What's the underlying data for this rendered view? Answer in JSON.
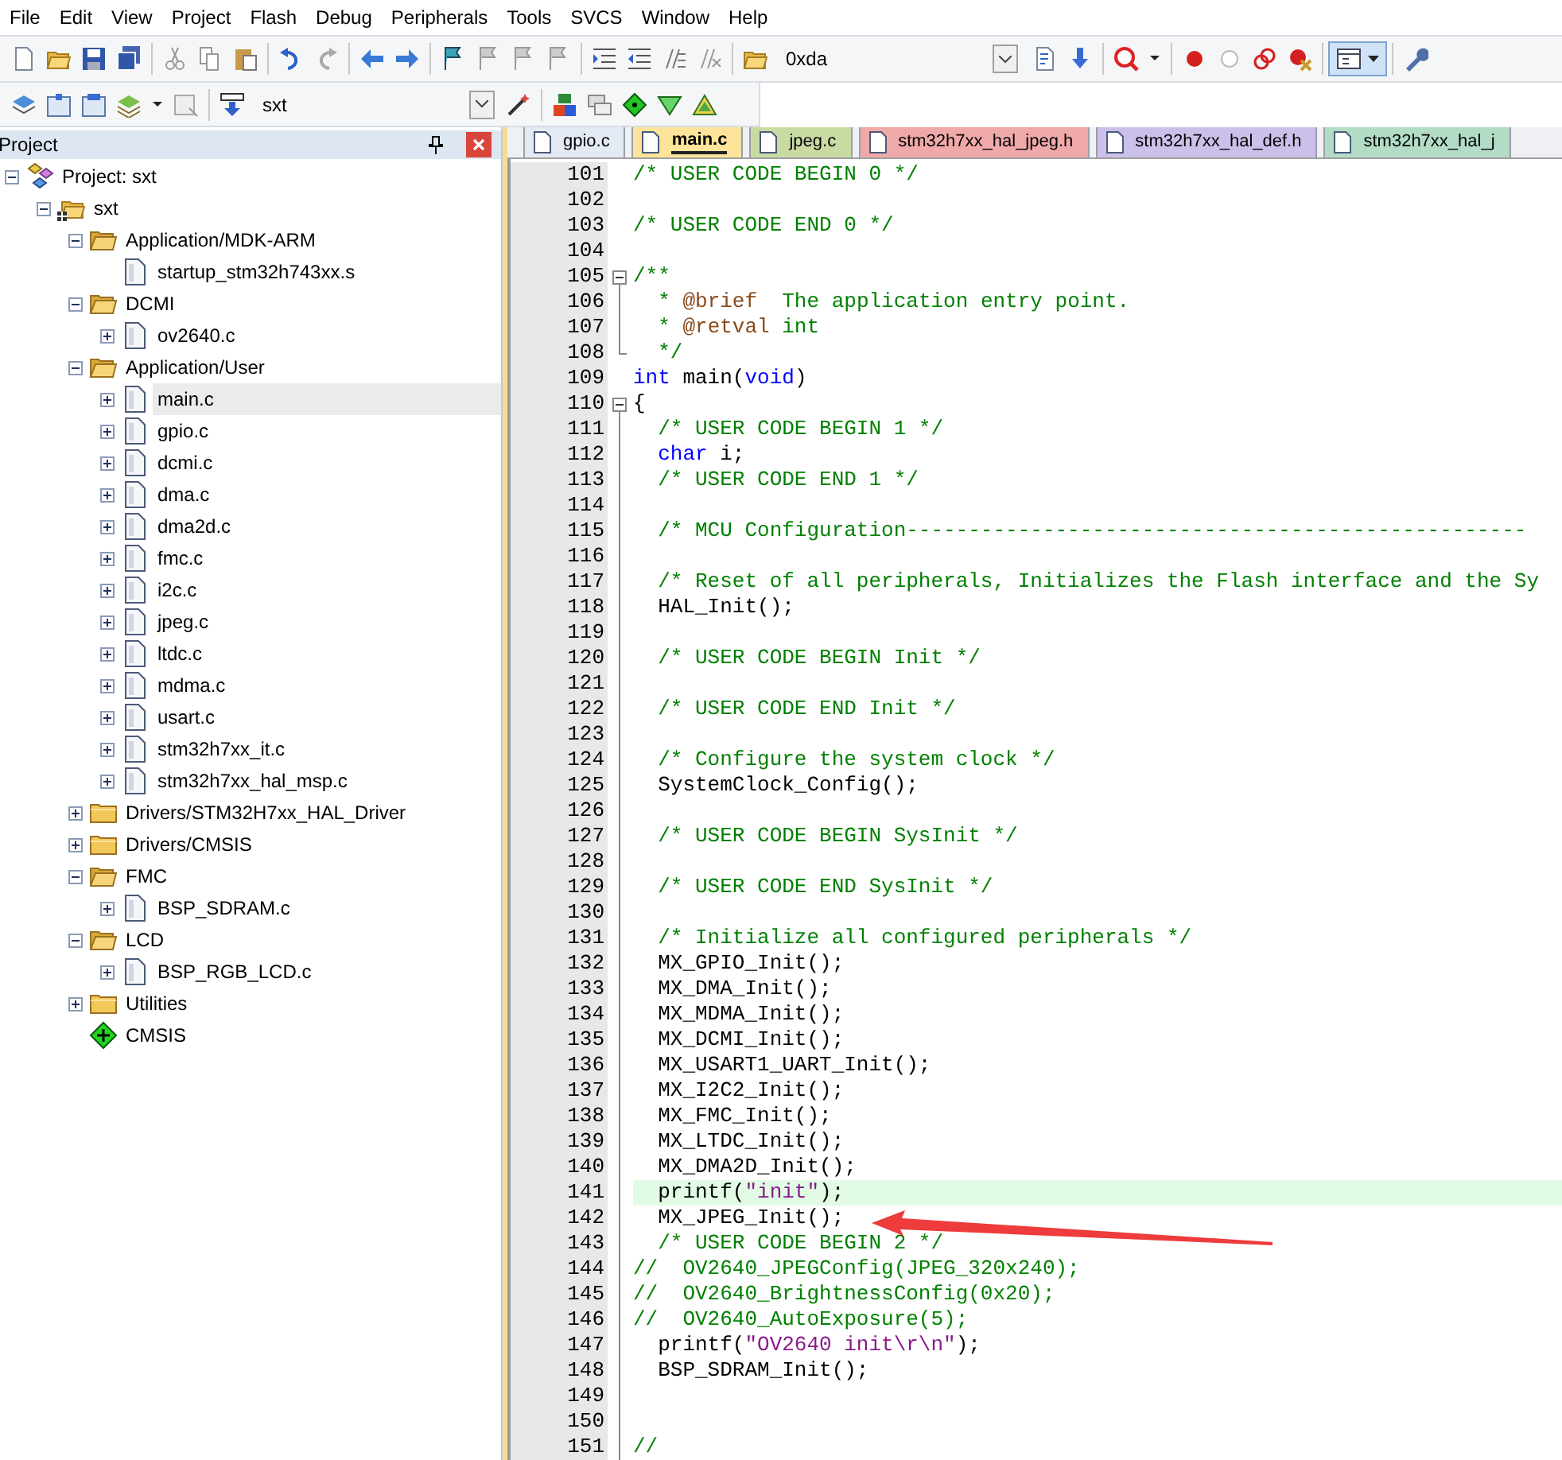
{
  "menu": [
    "File",
    "Edit",
    "View",
    "Project",
    "Flash",
    "Debug",
    "Peripherals",
    "Tools",
    "SVCS",
    "Window",
    "Help"
  ],
  "toolbar": {
    "find_combo": {
      "value": "0xda"
    },
    "target_combo": {
      "value": "sxt"
    }
  },
  "project_panel": {
    "title": "Project",
    "tree": [
      {
        "label": "Project: sxt",
        "kind": "project",
        "expanded": true,
        "selected": false,
        "children": [
          {
            "label": "sxt",
            "kind": "target",
            "expanded": true,
            "selected": false,
            "children": [
              {
                "label": "Application/MDK-ARM",
                "kind": "group",
                "expanded": true,
                "selected": false,
                "children": [
                  {
                    "label": "startup_stm32h743xx.s",
                    "kind": "file",
                    "selected": false
                  }
                ]
              },
              {
                "label": "DCMI",
                "kind": "group",
                "expanded": true,
                "selected": false,
                "children": [
                  {
                    "label": "ov2640.c",
                    "kind": "file",
                    "expanded": false,
                    "selected": false
                  }
                ]
              },
              {
                "label": "Application/User",
                "kind": "group",
                "expanded": true,
                "selected": false,
                "children": [
                  {
                    "label": "main.c",
                    "kind": "file",
                    "expanded": false,
                    "selected": true
                  },
                  {
                    "label": "gpio.c",
                    "kind": "file",
                    "expanded": false,
                    "selected": false
                  },
                  {
                    "label": "dcmi.c",
                    "kind": "file",
                    "expanded": false,
                    "selected": false
                  },
                  {
                    "label": "dma.c",
                    "kind": "file",
                    "expanded": false,
                    "selected": false
                  },
                  {
                    "label": "dma2d.c",
                    "kind": "file",
                    "expanded": false,
                    "selected": false
                  },
                  {
                    "label": "fmc.c",
                    "kind": "file",
                    "expanded": false,
                    "selected": false
                  },
                  {
                    "label": "i2c.c",
                    "kind": "file",
                    "expanded": false,
                    "selected": false
                  },
                  {
                    "label": "jpeg.c",
                    "kind": "file",
                    "expanded": false,
                    "selected": false
                  },
                  {
                    "label": "ltdc.c",
                    "kind": "file",
                    "expanded": false,
                    "selected": false
                  },
                  {
                    "label": "mdma.c",
                    "kind": "file",
                    "expanded": false,
                    "selected": false
                  },
                  {
                    "label": "usart.c",
                    "kind": "file",
                    "expanded": false,
                    "selected": false
                  },
                  {
                    "label": "stm32h7xx_it.c",
                    "kind": "file",
                    "expanded": false,
                    "selected": false
                  },
                  {
                    "label": "stm32h7xx_hal_msp.c",
                    "kind": "file",
                    "expanded": false,
                    "selected": false
                  }
                ]
              },
              {
                "label": "Drivers/STM32H7xx_HAL_Driver",
                "kind": "group",
                "expanded": false,
                "selected": false
              },
              {
                "label": "Drivers/CMSIS",
                "kind": "group",
                "expanded": false,
                "selected": false
              },
              {
                "label": "FMC",
                "kind": "group",
                "expanded": true,
                "selected": false,
                "children": [
                  {
                    "label": "BSP_SDRAM.c",
                    "kind": "file",
                    "expanded": false,
                    "selected": false
                  }
                ]
              },
              {
                "label": "LCD",
                "kind": "group",
                "expanded": true,
                "selected": false,
                "children": [
                  {
                    "label": "BSP_RGB_LCD.c",
                    "kind": "file",
                    "expanded": false,
                    "selected": false
                  }
                ]
              },
              {
                "label": "Utilities",
                "kind": "group",
                "expanded": false,
                "selected": false
              },
              {
                "label": "CMSIS",
                "kind": "component",
                "selected": false
              }
            ]
          }
        ]
      }
    ]
  },
  "editor": {
    "tabs": [
      {
        "label": "gpio.c",
        "selected": false,
        "color": "#e4eaf4"
      },
      {
        "label": "main.c",
        "selected": true,
        "color": "#fde49a"
      },
      {
        "label": "jpeg.c",
        "selected": false,
        "color": "#c9dba3"
      },
      {
        "label": "stm32h7xx_hal_jpeg.h",
        "selected": false,
        "color": "#f0a9a9"
      },
      {
        "label": "stm32h7xx_hal_def.h",
        "selected": false,
        "color": "#cbc0ea"
      },
      {
        "label": "stm32h7xx_hal_j",
        "selected": false,
        "color": "#b2dcc6"
      }
    ],
    "lines": [
      {
        "number": "101",
        "highlighted": false,
        "kind": "plain",
        "tokens": [
          {
            "kind": "comment",
            "text": "/* USER CODE BEGIN 0 */"
          }
        ]
      },
      {
        "number": "102",
        "highlighted": false,
        "kind": "plain"
      },
      {
        "number": "103",
        "highlighted": false,
        "kind": "plain",
        "tokens": [
          {
            "kind": "comment",
            "text": "/* USER CODE END 0 */"
          }
        ]
      },
      {
        "number": "104",
        "highlighted": false,
        "kind": "plain"
      },
      {
        "number": "105",
        "highlighted": false,
        "kind": "opener",
        "tokens": [
          {
            "kind": "comment",
            "text": "/**"
          }
        ]
      },
      {
        "number": "106",
        "highlighted": false,
        "kind": "body",
        "tokens": [
          {
            "kind": "comment",
            "text": "  * "
          },
          {
            "kind": "doc-tag",
            "text": "@brief"
          },
          {
            "kind": "comment",
            "text": "  The application entry point."
          }
        ]
      },
      {
        "number": "107",
        "highlighted": false,
        "kind": "body",
        "tokens": [
          {
            "kind": "comment",
            "text": "  * "
          },
          {
            "kind": "doc-tag",
            "text": "@retval"
          },
          {
            "kind": "comment",
            "text": " int"
          }
        ]
      },
      {
        "number": "108",
        "highlighted": false,
        "kind": "closer",
        "tokens": [
          {
            "kind": "comment",
            "text": "  */"
          }
        ]
      },
      {
        "number": "109",
        "highlighted": false,
        "kind": "plain",
        "tokens": [
          {
            "kind": "keyword",
            "text": "int"
          },
          {
            "kind": "plain",
            "text": " main("
          },
          {
            "kind": "keyword",
            "text": "void"
          },
          {
            "kind": "plain",
            "text": ")"
          }
        ]
      },
      {
        "number": "110",
        "highlighted": false,
        "kind": "opener",
        "tokens": [
          {
            "kind": "plain",
            "text": "{"
          }
        ]
      },
      {
        "number": "111",
        "highlighted": false,
        "kind": "body",
        "tokens": [
          {
            "kind": "comment",
            "text": "  /* USER CODE BEGIN 1 */"
          }
        ]
      },
      {
        "number": "112",
        "highlighted": false,
        "kind": "body",
        "tokens": [
          {
            "kind": "keyword",
            "text": "  char"
          },
          {
            "kind": "plain",
            "text": " i;"
          }
        ]
      },
      {
        "number": "113",
        "highlighted": false,
        "kind": "body",
        "tokens": [
          {
            "kind": "comment",
            "text": "  /* USER CODE END 1 */"
          }
        ]
      },
      {
        "number": "114",
        "highlighted": false,
        "kind": "body"
      },
      {
        "number": "115",
        "highlighted": false,
        "kind": "body",
        "tokens": [
          {
            "kind": "comment",
            "text": "  /* MCU Configuration--------------------------------------------------"
          }
        ]
      },
      {
        "number": "116",
        "highlighted": false,
        "kind": "body"
      },
      {
        "number": "117",
        "highlighted": false,
        "kind": "body",
        "tokens": [
          {
            "kind": "comment",
            "text": "  /* Reset of all peripherals, Initializes the Flash interface and the Sy"
          }
        ]
      },
      {
        "number": "118",
        "highlighted": false,
        "kind": "body",
        "tokens": [
          {
            "kind": "plain",
            "text": "  HAL_Init();"
          }
        ]
      },
      {
        "number": "119",
        "highlighted": false,
        "kind": "body"
      },
      {
        "number": "120",
        "highlighted": false,
        "kind": "body",
        "tokens": [
          {
            "kind": "comment",
            "text": "  /* USER CODE BEGIN Init */"
          }
        ]
      },
      {
        "number": "121",
        "highlighted": false,
        "kind": "body"
      },
      {
        "number": "122",
        "highlighted": false,
        "kind": "body",
        "tokens": [
          {
            "kind": "comment",
            "text": "  /* USER CODE END Init */"
          }
        ]
      },
      {
        "number": "123",
        "highlighted": false,
        "kind": "body"
      },
      {
        "number": "124",
        "highlighted": false,
        "kind": "body",
        "tokens": [
          {
            "kind": "comment",
            "text": "  /* Configure the system clock */"
          }
        ]
      },
      {
        "number": "125",
        "highlighted": false,
        "kind": "body",
        "tokens": [
          {
            "kind": "plain",
            "text": "  SystemClock_Config();"
          }
        ]
      },
      {
        "number": "126",
        "highlighted": false,
        "kind": "body"
      },
      {
        "number": "127",
        "highlighted": false,
        "kind": "body",
        "tokens": [
          {
            "kind": "comment",
            "text": "  /* USER CODE BEGIN SysInit */"
          }
        ]
      },
      {
        "number": "128",
        "highlighted": false,
        "kind": "body"
      },
      {
        "number": "129",
        "highlighted": false,
        "kind": "body",
        "tokens": [
          {
            "kind": "comment",
            "text": "  /* USER CODE END SysInit */"
          }
        ]
      },
      {
        "number": "130",
        "highlighted": false,
        "kind": "body"
      },
      {
        "number": "131",
        "highlighted": false,
        "kind": "body",
        "tokens": [
          {
            "kind": "comment",
            "text": "  /* Initialize all configured peripherals */"
          }
        ]
      },
      {
        "number": "132",
        "highlighted": false,
        "kind": "body",
        "tokens": [
          {
            "kind": "plain",
            "text": "  MX_GPIO_Init();"
          }
        ]
      },
      {
        "number": "133",
        "highlighted": false,
        "kind": "body",
        "tokens": [
          {
            "kind": "plain",
            "text": "  MX_DMA_Init();"
          }
        ]
      },
      {
        "number": "134",
        "highlighted": false,
        "kind": "body",
        "tokens": [
          {
            "kind": "plain",
            "text": "  MX_MDMA_Init();"
          }
        ]
      },
      {
        "number": "135",
        "highlighted": false,
        "kind": "body",
        "tokens": [
          {
            "kind": "plain",
            "text": "  MX_DCMI_Init();"
          }
        ]
      },
      {
        "number": "136",
        "highlighted": false,
        "kind": "body",
        "tokens": [
          {
            "kind": "plain",
            "text": "  MX_USART1_UART_Init();"
          }
        ]
      },
      {
        "number": "137",
        "highlighted": false,
        "kind": "body",
        "tokens": [
          {
            "kind": "plain",
            "text": "  MX_I2C2_Init();"
          }
        ]
      },
      {
        "number": "138",
        "highlighted": false,
        "kind": "body",
        "tokens": [
          {
            "kind": "plain",
            "text": "  MX_FMC_Init();"
          }
        ]
      },
      {
        "number": "139",
        "highlighted": false,
        "kind": "body",
        "tokens": [
          {
            "kind": "plain",
            "text": "  MX_LTDC_Init();"
          }
        ]
      },
      {
        "number": "140",
        "highlighted": false,
        "kind": "body",
        "tokens": [
          {
            "kind": "plain",
            "text": "  MX_DMA2D_Init();"
          }
        ]
      },
      {
        "number": "141",
        "highlighted": true,
        "kind": "body",
        "tokens": [
          {
            "kind": "plain",
            "text": "  printf("
          },
          {
            "kind": "string",
            "text": "\"init\""
          },
          {
            "kind": "plain",
            "text": ");"
          }
        ]
      },
      {
        "number": "142",
        "highlighted": false,
        "kind": "body",
        "tokens": [
          {
            "kind": "plain",
            "text": "  MX_JPEG_Init();"
          }
        ]
      },
      {
        "number": "143",
        "highlighted": false,
        "kind": "body",
        "tokens": [
          {
            "kind": "comment",
            "text": "  /* USER CODE BEGIN 2 */"
          }
        ]
      },
      {
        "number": "144",
        "highlighted": false,
        "kind": "body",
        "tokens": [
          {
            "kind": "comment",
            "text": "//  OV2640_JPEGConfig(JPEG_320x240);"
          }
        ]
      },
      {
        "number": "145",
        "highlighted": false,
        "kind": "body",
        "tokens": [
          {
            "kind": "comment",
            "text": "//  OV2640_BrightnessConfig(0x20);"
          }
        ]
      },
      {
        "number": "146",
        "highlighted": false,
        "kind": "body",
        "tokens": [
          {
            "kind": "comment",
            "text": "//  OV2640_AutoExposure(5);"
          }
        ]
      },
      {
        "number": "147",
        "highlighted": false,
        "kind": "body",
        "tokens": [
          {
            "kind": "plain",
            "text": "  printf("
          },
          {
            "kind": "string",
            "text": "\"OV2640 init\\r\\n\""
          },
          {
            "kind": "plain",
            "text": ");"
          }
        ]
      },
      {
        "number": "148",
        "highlighted": false,
        "kind": "body",
        "tokens": [
          {
            "kind": "plain",
            "text": "  BSP_SDRAM_Init();"
          }
        ]
      },
      {
        "number": "149",
        "highlighted": false,
        "kind": "body"
      },
      {
        "number": "150",
        "highlighted": false,
        "kind": "body"
      },
      {
        "number": "151",
        "highlighted": false,
        "kind": "body",
        "tokens": [
          {
            "kind": "comment",
            "text": "//"
          }
        ]
      }
    ]
  }
}
